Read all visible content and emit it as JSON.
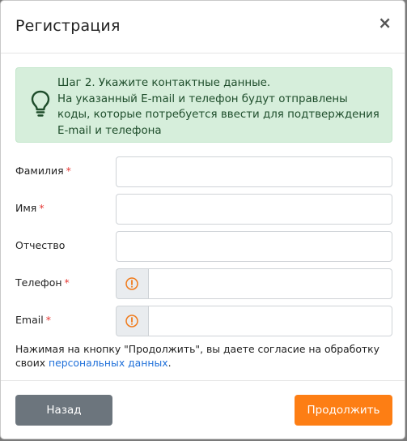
{
  "modal": {
    "title": "Регистрация",
    "close_symbol": "×"
  },
  "alert": {
    "icon": "lightbulb-icon",
    "line1": "Шаг 2. Укажите контактные данные.",
    "line2": "На указанный E-mail и телефон будут отправлены коды, которые потребуется ввести для подтверждения E-mail и телефона"
  },
  "form": {
    "required_mark": "*",
    "fields": [
      {
        "label": "Фамилия",
        "required": true,
        "value": ""
      },
      {
        "label": "Имя",
        "required": true,
        "value": ""
      },
      {
        "label": "Отчество",
        "required": false,
        "value": ""
      },
      {
        "label": "Телефон",
        "required": true,
        "value": "",
        "addon_icon": "warning-icon"
      },
      {
        "label": "Email",
        "required": true,
        "value": "",
        "addon_icon": "warning-icon"
      }
    ]
  },
  "consent": {
    "text": "Нажимая на кнопку \"Продолжить\", вы даете согласие на обработку своих ",
    "link": "персональных данных",
    "end": "."
  },
  "footer": {
    "back_label": "Назад",
    "next_label": "Продолжить"
  },
  "colors": {
    "alert_bg": "#d6eedb",
    "back_button": "#6c757d",
    "next_button": "#fd7e14",
    "required": "#e53935",
    "link": "#1e6fd9",
    "warning": "#f07a1a"
  }
}
